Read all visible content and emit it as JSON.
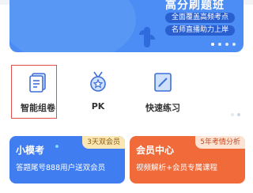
{
  "banner": {
    "headline": "高分刷题班",
    "pill1": "全面覆盖高频考点",
    "pill2": "名师直播助力上岸"
  },
  "actions": [
    {
      "label": "智能组卷",
      "icon": "smart-paper-icon"
    },
    {
      "label": "PK",
      "icon": "medal-star-icon"
    },
    {
      "label": "快速练习",
      "icon": "quick-practice-icon"
    }
  ],
  "cards": {
    "left": {
      "title": "小模考",
      "tag": "3天双会员",
      "subtitle": "答题尾号888用户送双会员"
    },
    "right": {
      "title": "会员中心",
      "tag": "5年考情分析",
      "subtitle": "视频解析+会员专属课程"
    }
  },
  "colors": {
    "accent_blue": "#4b8df5",
    "card_blue": "#3f7df0",
    "card_orange": "#f06a3a",
    "highlight_red": "#e0504f"
  }
}
